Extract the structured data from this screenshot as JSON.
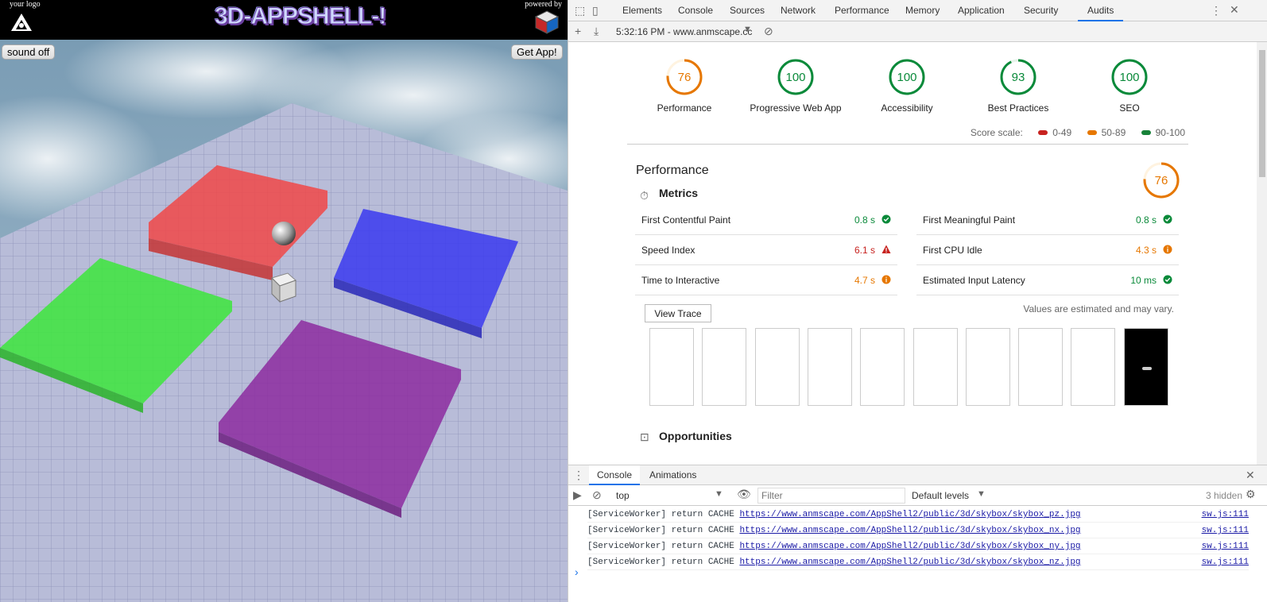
{
  "app": {
    "logo_caption": "your logo",
    "title": "3D-APPSHELL-!",
    "powered_caption": "powered by",
    "sound_button": "sound off",
    "get_app_button": "Get App!",
    "colors": {
      "red_pad": "#f04848",
      "blue_pad": "#3a3af0",
      "green_pad": "#3ce63c",
      "purple_pad": "#8c2ca0",
      "floor": "#b8bcd8"
    }
  },
  "devtools": {
    "tabs": [
      "Elements",
      "Console",
      "Sources",
      "Network",
      "Performance",
      "Memory",
      "Application",
      "Security",
      "Audits"
    ],
    "active_tab": "Audits",
    "report_selector": "5:32:16 PM - www.anmscape.cc",
    "icons": [
      "inspect-icon",
      "device-toggle-icon",
      "more-icon",
      "close-icon",
      "add-icon",
      "download-icon",
      "clear-icon"
    ]
  },
  "audits": {
    "gauges": [
      {
        "score": 76,
        "label": "Performance",
        "color": "#e67700"
      },
      {
        "score": 100,
        "label": "Progressive Web App",
        "color": "#0a8a3a"
      },
      {
        "score": 100,
        "label": "Accessibility",
        "color": "#0a8a3a"
      },
      {
        "score": 93,
        "label": "Best Practices",
        "color": "#0a8a3a"
      },
      {
        "score": 100,
        "label": "SEO",
        "color": "#0a8a3a"
      }
    ],
    "score_scale": {
      "label": "Score scale:",
      "ranges": [
        {
          "label": "0-49",
          "color": "#c7221f"
        },
        {
          "label": "50-89",
          "color": "#e67700"
        },
        {
          "label": "90-100",
          "color": "#178239"
        }
      ]
    },
    "performance_title": "Performance",
    "performance_score": 76,
    "metrics_heading": "Metrics",
    "metrics": [
      {
        "name": "First Contentful Paint",
        "value": "0.8 s",
        "status": "pass"
      },
      {
        "name": "First Meaningful Paint",
        "value": "0.8 s",
        "status": "pass"
      },
      {
        "name": "Speed Index",
        "value": "6.1 s",
        "status": "fail"
      },
      {
        "name": "First CPU Idle",
        "value": "4.3 s",
        "status": "average"
      },
      {
        "name": "Time to Interactive",
        "value": "4.7 s",
        "status": "average"
      },
      {
        "name": "Estimated Input Latency",
        "value": "10 ms",
        "status": "pass"
      }
    ],
    "view_trace": "View Trace",
    "values_note": "Values are estimated and may vary.",
    "opportunities_heading": "Opportunities"
  },
  "console": {
    "tabs": [
      "Console",
      "Animations"
    ],
    "context": "top",
    "filter_placeholder": "Filter",
    "levels": "Default levels",
    "hidden": "3 hidden",
    "lines": [
      {
        "prefix": "[ServiceWorker] return CACHE",
        "url": "https://www.anmscape.com/AppShell2/public/3d/skybox/skybox_pz.jpg",
        "source": "sw.js:111"
      },
      {
        "prefix": "[ServiceWorker] return CACHE",
        "url": "https://www.anmscape.com/AppShell2/public/3d/skybox/skybox_nx.jpg",
        "source": "sw.js:111"
      },
      {
        "prefix": "[ServiceWorker] return CACHE",
        "url": "https://www.anmscape.com/AppShell2/public/3d/skybox/skybox_ny.jpg",
        "source": "sw.js:111"
      },
      {
        "prefix": "[ServiceWorker] return CACHE",
        "url": "https://www.anmscape.com/AppShell2/public/3d/skybox/skybox_nz.jpg",
        "source": "sw.js:111"
      }
    ],
    "prompt": "›"
  }
}
